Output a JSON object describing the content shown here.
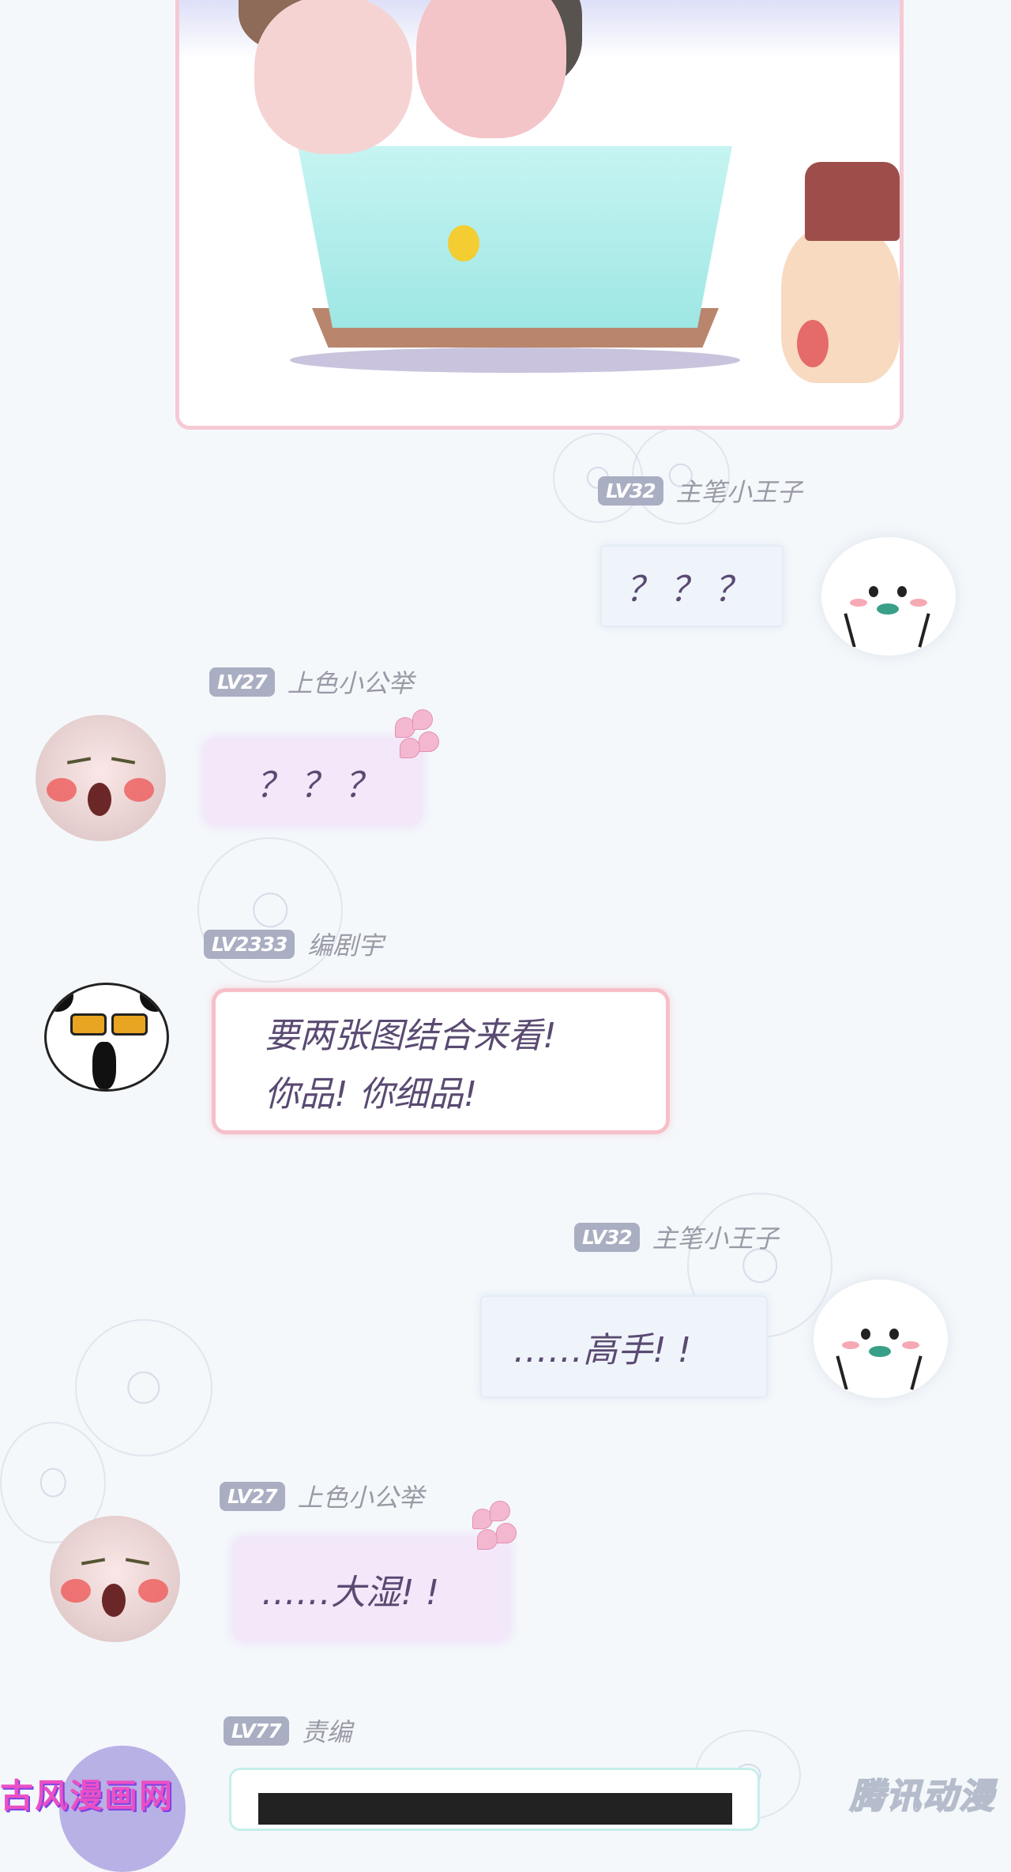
{
  "messages": [
    {
      "level": "LV32",
      "name": "主笔小王子",
      "text": "？？？",
      "side": "right"
    },
    {
      "level": "LV27",
      "name": "上色小公举",
      "text": "？？？",
      "side": "left"
    },
    {
      "level": "LV2333",
      "name": "编剧宇",
      "line1": "要两张图结合来看!",
      "line2": "你品!  你细品!",
      "side": "left"
    },
    {
      "level": "LV32",
      "name": "主笔小王子",
      "text": "……高手!  !",
      "side": "right"
    },
    {
      "level": "LV27",
      "name": "上色小公举",
      "text": "……大湿!  !",
      "side": "left"
    },
    {
      "level": "LV77",
      "name": "责编",
      "side": "left"
    }
  ],
  "watermarks": {
    "left": "古风漫画网",
    "right": "腾讯动漫"
  },
  "colors": {
    "background": "#f4f8fb",
    "level_badge": "#a9aec2",
    "bubble_text": "#5a4a72",
    "pink_border": "#f6c0c9"
  }
}
